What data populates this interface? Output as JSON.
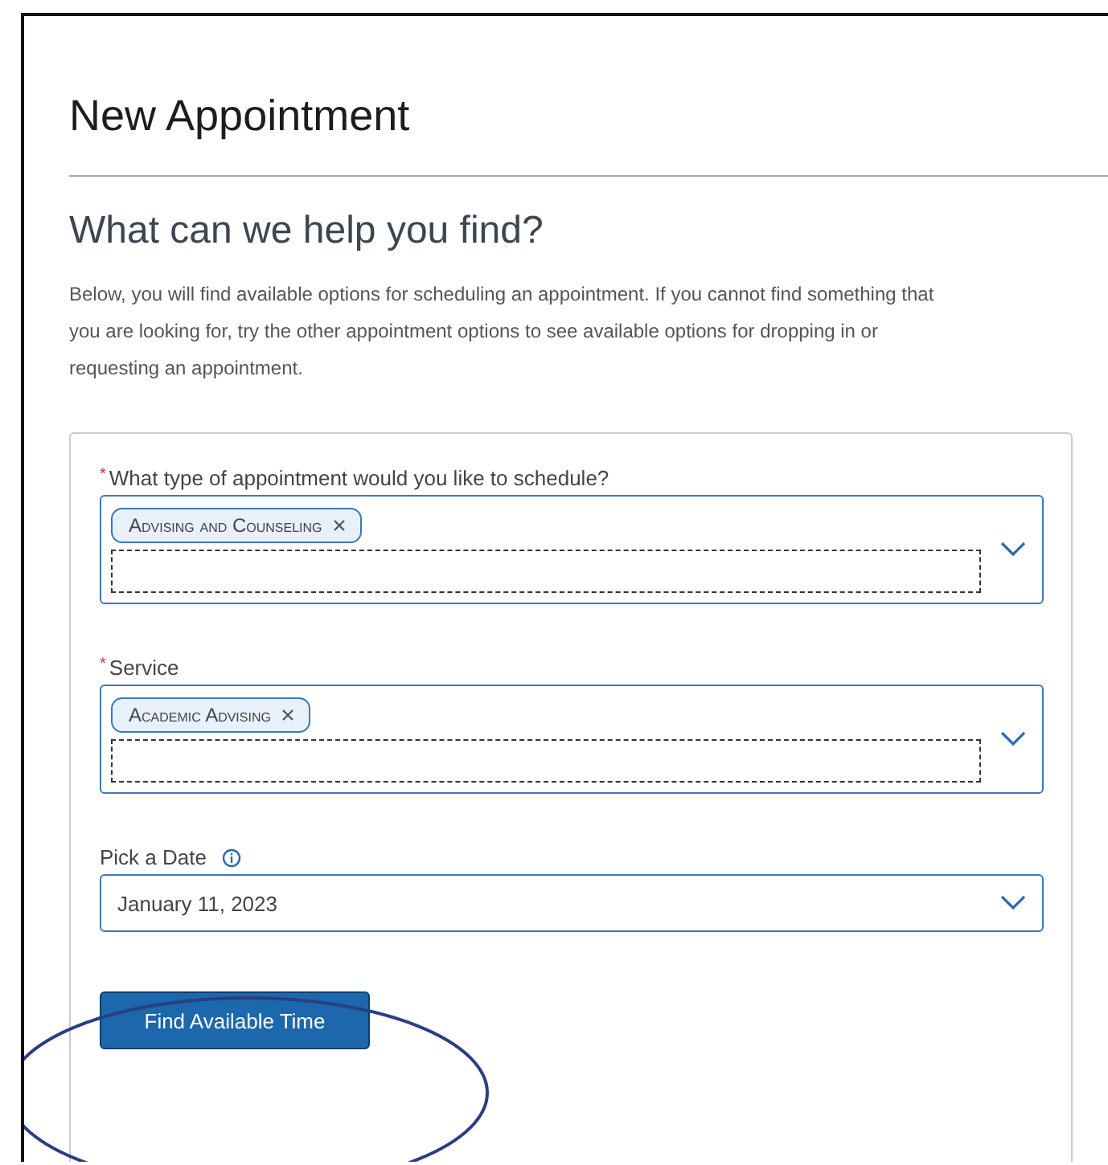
{
  "title": "New Appointment",
  "heading": "What can we help you find?",
  "intro": "Below, you will find available options for scheduling an appointment. If you cannot find something that you are looking for, try the other appointment options to see available options for dropping in or requesting an appointment.",
  "fields": [
    {
      "kind": "multiselect",
      "label": "What type of appointment would you like to schedule?",
      "required": true,
      "required_mark": "*",
      "chips": [
        "Advising and Counseling"
      ]
    },
    {
      "kind": "multiselect",
      "label": "Service",
      "required": true,
      "required_mark": "*",
      "chips": [
        "Academic Advising"
      ]
    },
    {
      "kind": "select",
      "label": "Pick a Date",
      "required": false,
      "info": true,
      "value": "January 11, 2023"
    }
  ],
  "button": "Find Available Time",
  "annotation": {
    "kind": "ellipse"
  }
}
